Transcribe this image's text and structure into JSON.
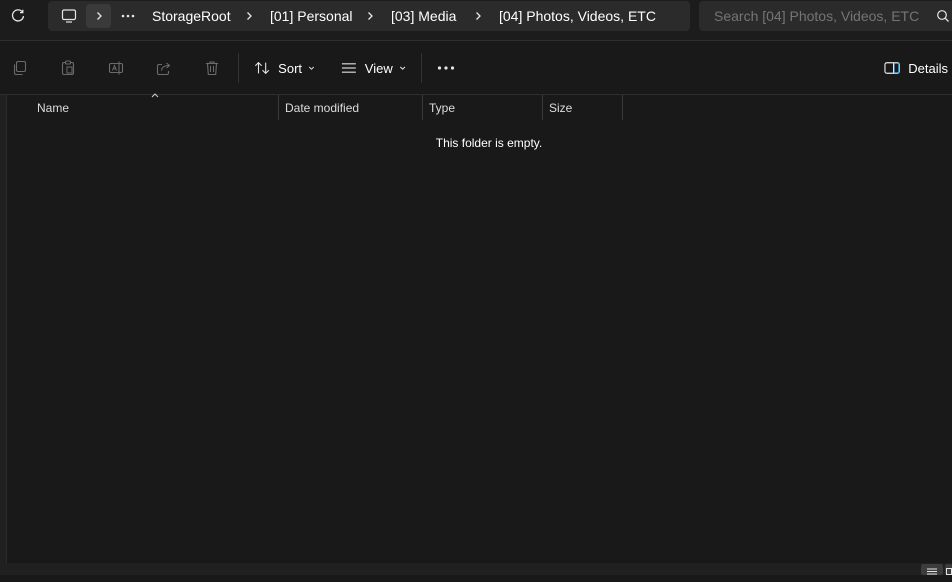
{
  "address_bar": {
    "crumbs": [
      "StorageRoot",
      "[01] Personal",
      "[03] Media",
      "[04] Photos, Videos, ETC"
    ]
  },
  "search": {
    "placeholder": "Search [04] Photos, Videos, ETC"
  },
  "toolbar": {
    "sort_label": "Sort",
    "view_label": "View",
    "details_label": "Details"
  },
  "columns": {
    "name": "Name",
    "date_modified": "Date modified",
    "type": "Type",
    "size": "Size"
  },
  "content": {
    "empty_message": "This folder is empty."
  },
  "colors": {
    "background": "#191919",
    "address_bg": "#2b2b2b",
    "accent": "#4cc2ff"
  },
  "icons": [
    "refresh-icon",
    "computer-icon",
    "chevron-right-icon",
    "more-horizontal-icon",
    "search-icon",
    "copy-icon",
    "paste-icon",
    "rename-icon",
    "share-icon",
    "delete-icon",
    "sort-icon",
    "view-icon",
    "chevron-down-icon",
    "details-pane-icon"
  ]
}
